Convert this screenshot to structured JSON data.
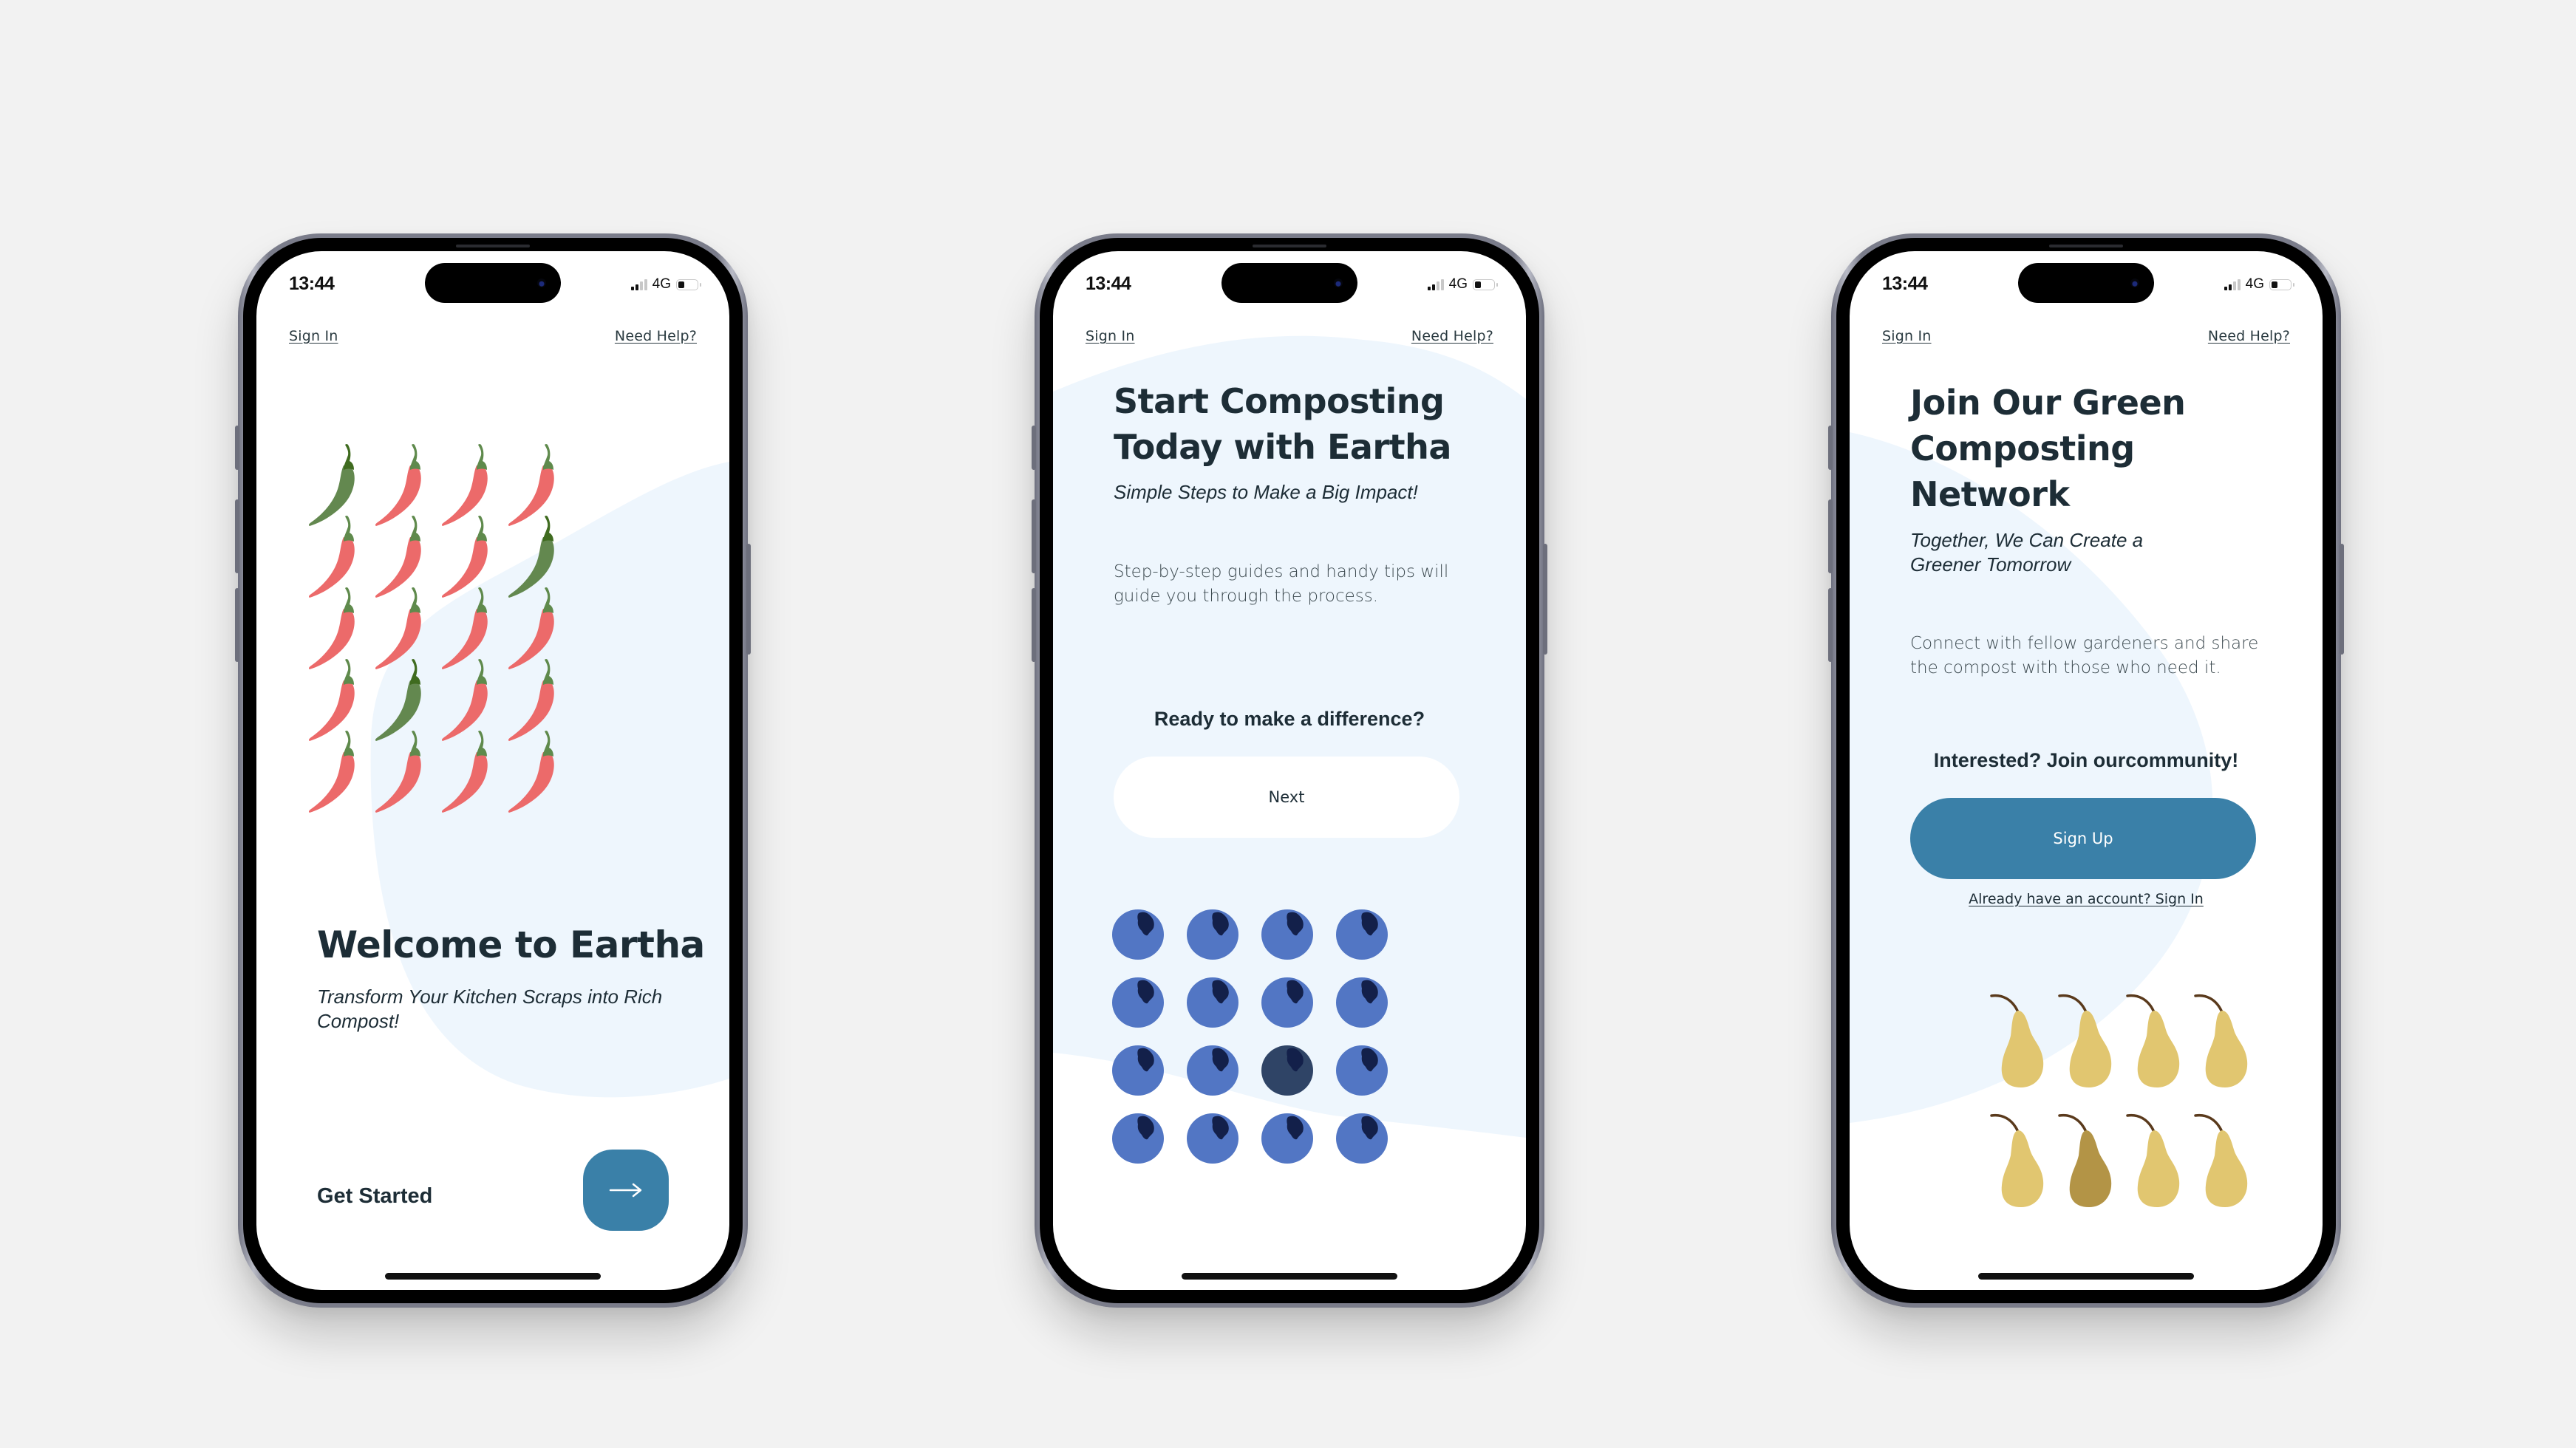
{
  "status_bar": {
    "time": "13:44",
    "network": "4G",
    "signal_bars_active": 2,
    "signal_bars_total": 4,
    "battery_level_pct": 35
  },
  "colors": {
    "background": "#f2f2f2",
    "accent_blue": "#3a80a8",
    "heading": "#1d2d36",
    "blob": "#eef6fd",
    "chili_red": "#ec6a6a",
    "chili_green": "#63884f",
    "stem_green": "#5f8a4c",
    "blueberry": "#5276c4",
    "blueberry_dark": "#2f4466",
    "blueberry_crown": "#13204a",
    "pear": "#e1c670",
    "pear_dark": "#b39446",
    "pear_stem": "#5a3a1c"
  },
  "screens": [
    {
      "top_left_link": "Sign In",
      "top_right_link": "Need Help?",
      "title": "Welcome to Eartha",
      "subtitle": "Transform Your Kitchen Scraps into Rich Compost!",
      "cta_label": "Get Started",
      "cta_icon": "arrow-right-icon",
      "illustration": {
        "type": "chili-pepper",
        "rows": 5,
        "cols": 4,
        "grid": [
          [
            "green",
            "red",
            "red",
            "red"
          ],
          [
            "red",
            "red",
            "red",
            "green"
          ],
          [
            "red",
            "red",
            "red",
            "red"
          ],
          [
            "red",
            "green",
            "red",
            "red"
          ],
          [
            "red",
            "red",
            "red",
            "red"
          ]
        ]
      }
    },
    {
      "top_left_link": "Sign In",
      "top_right_link": "Need Help?",
      "title_lines": [
        "Start Composting",
        "Today with Eartha"
      ],
      "subtitle": "Simple Steps to Make a Big Impact!",
      "body": "Step-by-step guides and handy tips will guide you through the process.",
      "prompt": "Ready to make a difference?",
      "button_label": "Next",
      "illustration": {
        "type": "blueberry",
        "rows": 4,
        "cols": 4,
        "grid": [
          [
            "normal",
            "normal",
            "normal",
            "normal"
          ],
          [
            "normal",
            "normal",
            "normal",
            "normal"
          ],
          [
            "normal",
            "normal",
            "dark",
            "normal"
          ],
          [
            "normal",
            "normal",
            "normal",
            "normal"
          ]
        ]
      }
    },
    {
      "top_left_link": "Sign In",
      "top_right_link": "Need Help?",
      "title_lines": [
        "Join Our Green",
        "Composting",
        "Network"
      ],
      "subtitle_lines": [
        "Together, We Can Create a",
        "Greener Tomorrow"
      ],
      "body": "Connect with fellow gardeners and share the compost with those who need it.",
      "prompt": "Interested? Join ourcommunity!",
      "button_label": "Sign Up",
      "secondary_link": "Already have an account? Sign In",
      "illustration": {
        "type": "pear",
        "rows": 2,
        "cols": 4,
        "grid": [
          [
            "normal",
            "normal",
            "normal",
            "normal"
          ],
          [
            "normal",
            "dark",
            "normal",
            "normal"
          ]
        ]
      }
    }
  ]
}
